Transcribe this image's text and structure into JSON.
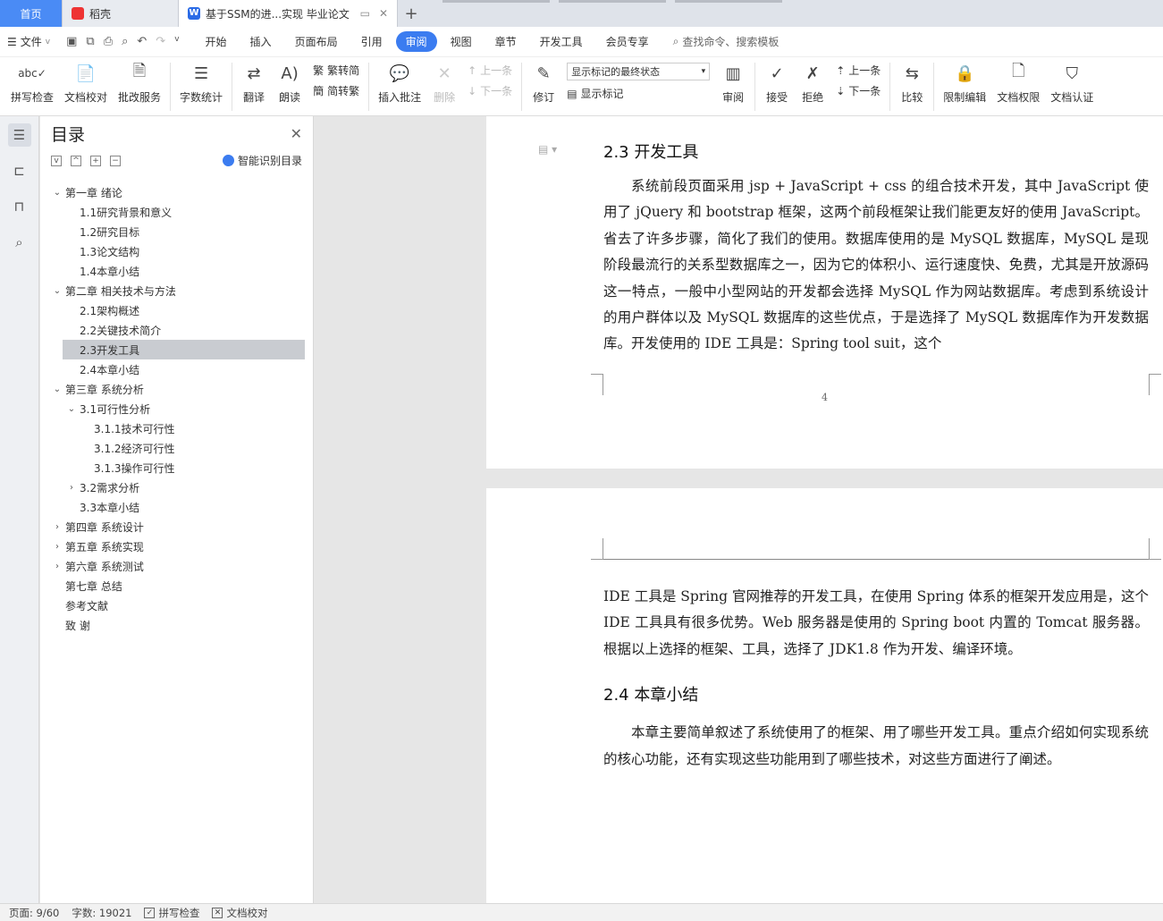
{
  "tabs": {
    "home": "首页",
    "daoke": "稻壳",
    "doc_title": "基于SSM的进...实现 毕业论文"
  },
  "menu": {
    "file": "文件",
    "tabs": [
      "开始",
      "插入",
      "页面布局",
      "引用",
      "审阅",
      "视图",
      "章节",
      "开发工具",
      "会员专享"
    ],
    "active_tab": "审阅",
    "search": "查找命令、搜索模板"
  },
  "toolbar": {
    "spell_check": "拼写检查",
    "doc_proofread": "文档校对",
    "review_service": "批改服务",
    "word_count": "字数统计",
    "translate": "翻译",
    "read_aloud": "朗读",
    "trad_to_simp": "繁转简",
    "simp_to_trad": "简转繁",
    "insert_comment": "插入批注",
    "delete": "删除",
    "prev": "上一条",
    "next": "下一条",
    "revise": "修订",
    "markup_state": "显示标记的最终状态",
    "show_markup": "显示标记",
    "review": "审阅",
    "accept": "接受",
    "reject": "拒绝",
    "prev2": "上一条",
    "next2": "下一条",
    "compare": "比较",
    "restrict_edit": "限制编辑",
    "doc_permission": "文档权限",
    "doc_certify": "文档认证"
  },
  "toc": {
    "title": "目录",
    "smart": "智能识别目录",
    "items": [
      {
        "label": "第一章  绪论",
        "level": 0,
        "arrow": "v"
      },
      {
        "label": "1.1研究背景和意义",
        "level": 1,
        "arrow": ""
      },
      {
        "label": "1.2研究目标",
        "level": 1,
        "arrow": ""
      },
      {
        "label": "1.3论文结构",
        "level": 1,
        "arrow": ""
      },
      {
        "label": "1.4本章小结",
        "level": 1,
        "arrow": ""
      },
      {
        "label": "第二章  相关技术与方法",
        "level": 0,
        "arrow": "v"
      },
      {
        "label": "2.1架构概述",
        "level": 1,
        "arrow": ""
      },
      {
        "label": "2.2关键技术简介",
        "level": 1,
        "arrow": ""
      },
      {
        "label": "2.3开发工具",
        "level": 1,
        "arrow": "",
        "selected": true
      },
      {
        "label": "2.4本章小结",
        "level": 1,
        "arrow": ""
      },
      {
        "label": "第三章  系统分析",
        "level": 0,
        "arrow": "v"
      },
      {
        "label": "3.1可行性分析",
        "level": 1,
        "arrow": "v"
      },
      {
        "label": "3.1.1技术可行性",
        "level": 2,
        "arrow": ""
      },
      {
        "label": "3.1.2经济可行性",
        "level": 2,
        "arrow": ""
      },
      {
        "label": "3.1.3操作可行性",
        "level": 2,
        "arrow": ""
      },
      {
        "label": "3.2需求分析",
        "level": 1,
        "arrow": ">"
      },
      {
        "label": "3.3本章小结",
        "level": 1,
        "arrow": ""
      },
      {
        "label": "第四章  系统设计",
        "level": 0,
        "arrow": ">"
      },
      {
        "label": "第五章  系统实现",
        "level": 0,
        "arrow": ">"
      },
      {
        "label": "第六章  系统测试",
        "level": 0,
        "arrow": ">"
      },
      {
        "label": "第七章  总结",
        "level": 0,
        "arrow": ""
      },
      {
        "label": "参考文献",
        "level": 0,
        "arrow": ""
      },
      {
        "label": "致    谢",
        "level": 0,
        "arrow": ""
      }
    ]
  },
  "document": {
    "heading_23": "2.3  开发工具",
    "para1": "系统前段页面采用 jsp + JavaScript + css 的组合技术开发，其中 JavaScript 使用了 jQuery 和 bootstrap 框架，这两个前段框架让我们能更友好的使用 JavaScript。省去了许多步骤，简化了我们的使用。数据库使用的是 MySQL 数据库，MySQL 是现阶段最流行的关系型数据库之一，因为它的体积小、运行速度快、免费，尤其是开放源码这一特点，一般中小型网站的开发都会选择 MySQL 作为网站数据库。考虑到系统设计的用户群体以及 MySQL 数据库的这些优点，于是选择了 MySQL 数据库作为开发数据库。开发使用的 IDE 工具是：Spring tool suit，这个",
    "page_number": "4",
    "para2": "IDE 工具是 Spring 官网推荐的开发工具，在使用 Spring 体系的框架开发应用是，这个 IDE 工具具有很多优势。Web 服务器是使用的 Spring boot 内置的 Tomcat 服务器。根据以上选择的框架、工具，选择了 JDK1.8 作为开发、编译环境。",
    "heading_24": "2.4  本章小结",
    "para3": "本章主要简单叙述了系统使用了的框架、用了哪些开发工具。重点介绍如何实现系统的核心功能，还有实现这些功能用到了哪些技术，对这些方面进行了阐述。"
  },
  "status": {
    "page": "页面: 9/60",
    "words": "字数: 19021",
    "spell": "拼写检查",
    "proof": "文档校对"
  },
  "colors": {
    "accent": "#3b7cf0",
    "selected_toc": "#c9ccd1"
  }
}
